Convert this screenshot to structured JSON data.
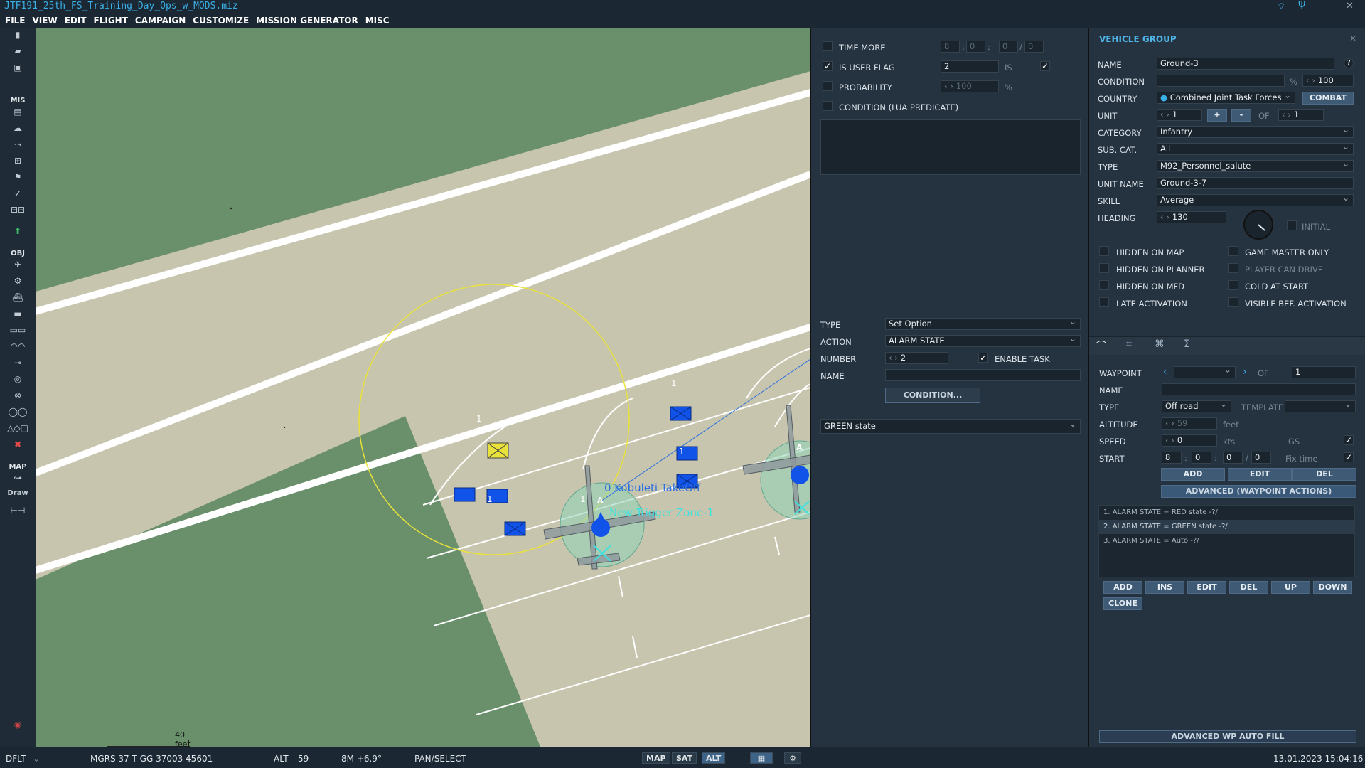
{
  "window": {
    "title": "JTF191_25th_FS_Training_Day_Ops_w_MODS.miz"
  },
  "menu": [
    "FILE",
    "VIEW",
    "EDIT",
    "FLIGHT",
    "CAMPAIGN",
    "CUSTOMIZE",
    "MISSION GENERATOR",
    "MISC"
  ],
  "toolbar": {
    "mis_label": "MIS",
    "obj_label": "OBJ",
    "map_label": "MAP",
    "draw_label": "Draw"
  },
  "map": {
    "scale_label": "40 feet",
    "takeoff_label": "0 Kobuleti TakeOff",
    "trigger_label": "New Trigger Zone-1",
    "aircraft_letter": "A",
    "unit_count": "1"
  },
  "trigger": {
    "time_more": {
      "label": "TIME MORE",
      "checked": false,
      "values": [
        "8",
        "0",
        "0",
        "0"
      ]
    },
    "is_user_flag": {
      "label": "IS USER FLAG",
      "checked": true,
      "flag": "2",
      "is_label": "IS",
      "is_checked": true
    },
    "probability": {
      "label": "PROBABILITY",
      "checked": false,
      "value": "100",
      "unit": "%"
    },
    "lua": {
      "label": "CONDITION (LUA PREDICATE)",
      "checked": false
    }
  },
  "action": {
    "type_label": "TYPE",
    "type_value": "Set Option",
    "action_label": "ACTION",
    "action_value": "ALARM STATE",
    "number_label": "NUMBER",
    "number_value": "2",
    "enable_task_label": "ENABLE TASK",
    "enable_task_checked": true,
    "name_label": "NAME",
    "name_value": "",
    "condition_button": "CONDITION...",
    "state_value": "GREEN state"
  },
  "vehicle": {
    "header": "VEHICLE GROUP",
    "name_label": "NAME",
    "name_value": "Ground-3",
    "help": "?",
    "condition_label": "CONDITION",
    "condition_pct": "%",
    "condition_value": "100",
    "country_label": "COUNTRY",
    "country_value": "Combined Joint Task Forces",
    "combat_button": "COMBAT",
    "unit_label": "UNIT",
    "unit_value": "1",
    "plus": "+",
    "minus": "-",
    "of_label": "OF",
    "unit_of": "1",
    "category_label": "CATEGORY",
    "category_value": "Infantry",
    "subcat_label": "SUB. CAT.",
    "subcat_value": "All",
    "type_label": "TYPE",
    "type_value": "M92_Personnel_salute",
    "unitname_label": "UNIT NAME",
    "unitname_value": "Ground-3-7",
    "skill_label": "SKILL",
    "skill_value": "Average",
    "heading_label": "HEADING",
    "heading_value": "130",
    "initial_label": "INITIAL",
    "flags": [
      {
        "label": "HIDDEN ON MAP",
        "checked": false,
        "disabled": false
      },
      {
        "label": "GAME MASTER ONLY",
        "checked": false,
        "disabled": false
      },
      {
        "label": "HIDDEN ON PLANNER",
        "checked": false,
        "disabled": false
      },
      {
        "label": "PLAYER CAN DRIVE",
        "checked": false,
        "disabled": true
      },
      {
        "label": "HIDDEN ON MFD",
        "checked": false,
        "disabled": false
      },
      {
        "label": "COLD AT START",
        "checked": false,
        "disabled": false
      },
      {
        "label": "LATE ACTIVATION",
        "checked": false,
        "disabled": false
      },
      {
        "label": "VISIBLE BEF. ACTIVATION",
        "checked": false,
        "disabled": false
      }
    ]
  },
  "waypoint": {
    "tabs": [
      "route-icon",
      "target-icon",
      "triggered-actions-icon",
      "summary-icon"
    ],
    "waypoint_label": "WAYPOINT",
    "of_label": "OF",
    "of_value": "1",
    "name_label": "NAME",
    "name_value": "",
    "type_label": "TYPE",
    "type_value": "Off road",
    "template_label": "TEMPLATE",
    "altitude_label": "ALTITUDE",
    "altitude_value": "59",
    "altitude_unit": "feet",
    "speed_label": "SPEED",
    "speed_value": "0",
    "speed_unit": "kts",
    "gs_label": "GS",
    "gs_checked": true,
    "start_label": "START",
    "start_values": [
      "8",
      "0",
      "0",
      "0"
    ],
    "fix_time_label": "Fix time",
    "fix_time_checked": true,
    "add": "ADD",
    "edit": "EDIT",
    "del": "DEL",
    "advanced": "ADVANCED (WAYPOINT ACTIONS)",
    "actions": [
      "1. ALARM STATE = RED state -?/",
      "2. ALARM STATE = GREEN state -?/",
      "3. ALARM STATE = Auto -?/"
    ],
    "selected_action": 1,
    "buttons": {
      "add": "ADD",
      "ins": "INS",
      "edit": "EDIT",
      "del": "DEL",
      "up": "UP",
      "down": "DOWN",
      "clone": "CLONE"
    },
    "auto_fill": "ADVANCED WP AUTO FILL"
  },
  "status": {
    "profile": "DFLT",
    "coords": "MGRS  37 T GG 37003 45601",
    "alt_label": "ALT",
    "alt_value": "59",
    "bearing": "8M  +6.9°",
    "mode": "PAN/SELECT",
    "map_btn": "MAP",
    "sat_btn": "SAT",
    "alt_btn": "ALT",
    "datetime": "13.01.2023 15:04:16"
  },
  "colors": {
    "accent": "#3ab0e6",
    "panel": "#25323f",
    "grass": "#698f6b",
    "runway": "#c8c5ae",
    "friendly": "#1153e8",
    "trigger": "#8fd3b8"
  }
}
